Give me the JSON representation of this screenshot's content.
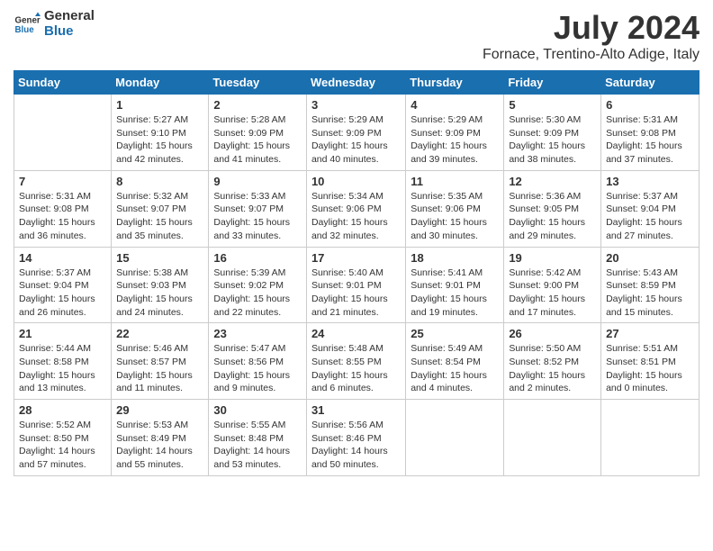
{
  "logo": {
    "text_general": "General",
    "text_blue": "Blue"
  },
  "title": "July 2024",
  "location": "Fornace, Trentino-Alto Adige, Italy",
  "days_of_week": [
    "Sunday",
    "Monday",
    "Tuesday",
    "Wednesday",
    "Thursday",
    "Friday",
    "Saturday"
  ],
  "weeks": [
    [
      {
        "day": "",
        "info": ""
      },
      {
        "day": "1",
        "info": "Sunrise: 5:27 AM\nSunset: 9:10 PM\nDaylight: 15 hours\nand 42 minutes."
      },
      {
        "day": "2",
        "info": "Sunrise: 5:28 AM\nSunset: 9:09 PM\nDaylight: 15 hours\nand 41 minutes."
      },
      {
        "day": "3",
        "info": "Sunrise: 5:29 AM\nSunset: 9:09 PM\nDaylight: 15 hours\nand 40 minutes."
      },
      {
        "day": "4",
        "info": "Sunrise: 5:29 AM\nSunset: 9:09 PM\nDaylight: 15 hours\nand 39 minutes."
      },
      {
        "day": "5",
        "info": "Sunrise: 5:30 AM\nSunset: 9:09 PM\nDaylight: 15 hours\nand 38 minutes."
      },
      {
        "day": "6",
        "info": "Sunrise: 5:31 AM\nSunset: 9:08 PM\nDaylight: 15 hours\nand 37 minutes."
      }
    ],
    [
      {
        "day": "7",
        "info": "Sunrise: 5:31 AM\nSunset: 9:08 PM\nDaylight: 15 hours\nand 36 minutes."
      },
      {
        "day": "8",
        "info": "Sunrise: 5:32 AM\nSunset: 9:07 PM\nDaylight: 15 hours\nand 35 minutes."
      },
      {
        "day": "9",
        "info": "Sunrise: 5:33 AM\nSunset: 9:07 PM\nDaylight: 15 hours\nand 33 minutes."
      },
      {
        "day": "10",
        "info": "Sunrise: 5:34 AM\nSunset: 9:06 PM\nDaylight: 15 hours\nand 32 minutes."
      },
      {
        "day": "11",
        "info": "Sunrise: 5:35 AM\nSunset: 9:06 PM\nDaylight: 15 hours\nand 30 minutes."
      },
      {
        "day": "12",
        "info": "Sunrise: 5:36 AM\nSunset: 9:05 PM\nDaylight: 15 hours\nand 29 minutes."
      },
      {
        "day": "13",
        "info": "Sunrise: 5:37 AM\nSunset: 9:04 PM\nDaylight: 15 hours\nand 27 minutes."
      }
    ],
    [
      {
        "day": "14",
        "info": "Sunrise: 5:37 AM\nSunset: 9:04 PM\nDaylight: 15 hours\nand 26 minutes."
      },
      {
        "day": "15",
        "info": "Sunrise: 5:38 AM\nSunset: 9:03 PM\nDaylight: 15 hours\nand 24 minutes."
      },
      {
        "day": "16",
        "info": "Sunrise: 5:39 AM\nSunset: 9:02 PM\nDaylight: 15 hours\nand 22 minutes."
      },
      {
        "day": "17",
        "info": "Sunrise: 5:40 AM\nSunset: 9:01 PM\nDaylight: 15 hours\nand 21 minutes."
      },
      {
        "day": "18",
        "info": "Sunrise: 5:41 AM\nSunset: 9:01 PM\nDaylight: 15 hours\nand 19 minutes."
      },
      {
        "day": "19",
        "info": "Sunrise: 5:42 AM\nSunset: 9:00 PM\nDaylight: 15 hours\nand 17 minutes."
      },
      {
        "day": "20",
        "info": "Sunrise: 5:43 AM\nSunset: 8:59 PM\nDaylight: 15 hours\nand 15 minutes."
      }
    ],
    [
      {
        "day": "21",
        "info": "Sunrise: 5:44 AM\nSunset: 8:58 PM\nDaylight: 15 hours\nand 13 minutes."
      },
      {
        "day": "22",
        "info": "Sunrise: 5:46 AM\nSunset: 8:57 PM\nDaylight: 15 hours\nand 11 minutes."
      },
      {
        "day": "23",
        "info": "Sunrise: 5:47 AM\nSunset: 8:56 PM\nDaylight: 15 hours\nand 9 minutes."
      },
      {
        "day": "24",
        "info": "Sunrise: 5:48 AM\nSunset: 8:55 PM\nDaylight: 15 hours\nand 6 minutes."
      },
      {
        "day": "25",
        "info": "Sunrise: 5:49 AM\nSunset: 8:54 PM\nDaylight: 15 hours\nand 4 minutes."
      },
      {
        "day": "26",
        "info": "Sunrise: 5:50 AM\nSunset: 8:52 PM\nDaylight: 15 hours\nand 2 minutes."
      },
      {
        "day": "27",
        "info": "Sunrise: 5:51 AM\nSunset: 8:51 PM\nDaylight: 15 hours\nand 0 minutes."
      }
    ],
    [
      {
        "day": "28",
        "info": "Sunrise: 5:52 AM\nSunset: 8:50 PM\nDaylight: 14 hours\nand 57 minutes."
      },
      {
        "day": "29",
        "info": "Sunrise: 5:53 AM\nSunset: 8:49 PM\nDaylight: 14 hours\nand 55 minutes."
      },
      {
        "day": "30",
        "info": "Sunrise: 5:55 AM\nSunset: 8:48 PM\nDaylight: 14 hours\nand 53 minutes."
      },
      {
        "day": "31",
        "info": "Sunrise: 5:56 AM\nSunset: 8:46 PM\nDaylight: 14 hours\nand 50 minutes."
      },
      {
        "day": "",
        "info": ""
      },
      {
        "day": "",
        "info": ""
      },
      {
        "day": "",
        "info": ""
      }
    ]
  ]
}
